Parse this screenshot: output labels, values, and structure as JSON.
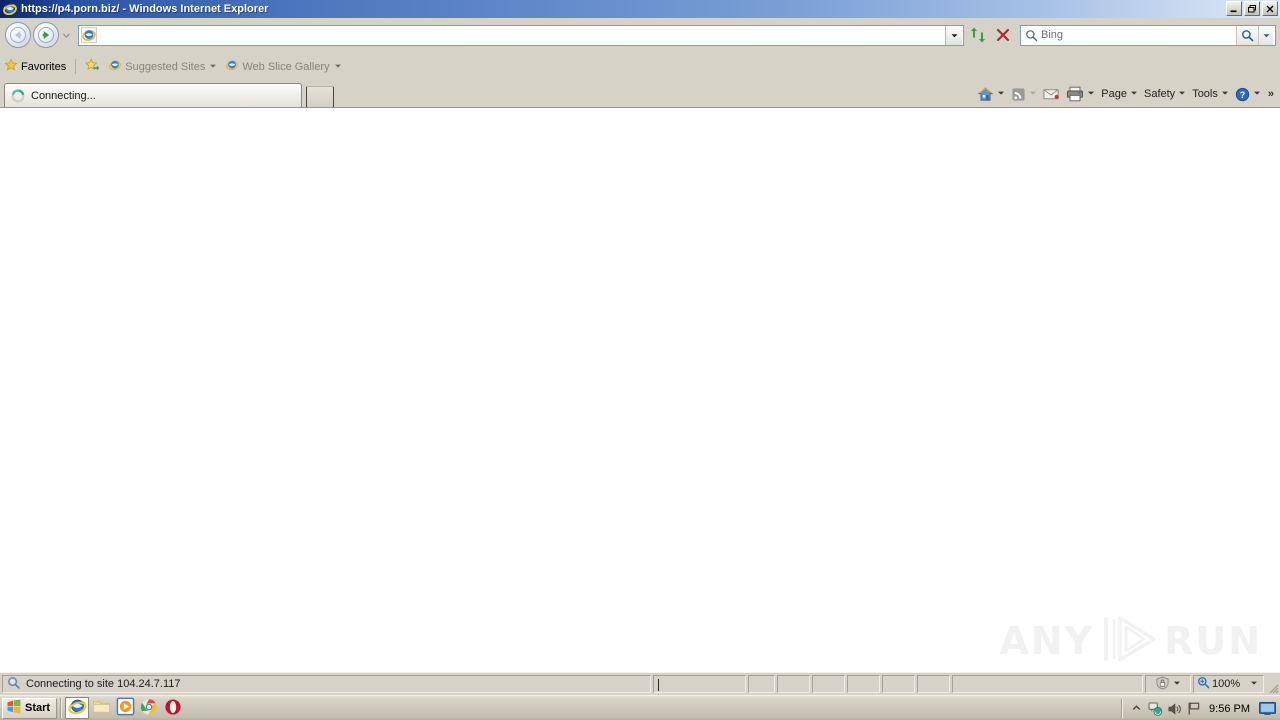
{
  "window": {
    "title": "https://p4.porn.biz/ - Windows Internet Explorer",
    "icon": "internet-explorer-icon",
    "controls": {
      "minimize_label": "Minimize",
      "restore_label": "Restore",
      "close_label": "Close"
    }
  },
  "navigation": {
    "back_label": "Back",
    "forward_label": "Forward",
    "recent_pages_label": "Recent Pages",
    "refresh_label": "Refresh",
    "stop_label": "Stop"
  },
  "address": {
    "value": "",
    "placeholder": "",
    "favicon": "internet-explorer-icon",
    "dropdown_label": "Address history"
  },
  "search": {
    "value": "",
    "placeholder": "Bing",
    "go_label": "Search",
    "options_label": "Search options"
  },
  "favorites_bar": {
    "favorites_label": "Favorites",
    "items": [
      {
        "label": "Suggested Sites",
        "icon": "internet-explorer-icon",
        "has_caret": true
      },
      {
        "label": "Web Slice Gallery",
        "icon": "internet-explorer-icon",
        "has_caret": true
      }
    ],
    "add_to_favorites_label": "Add to Favorites Bar"
  },
  "tabs": [
    {
      "label": "Connecting...",
      "icon": "loading-spinner-icon",
      "active": true
    }
  ],
  "new_tab_label": "New Tab",
  "command_bar": {
    "items": [
      {
        "name": "home",
        "label": "",
        "icon": "home-icon",
        "caret": true
      },
      {
        "name": "feeds",
        "label": "",
        "icon": "rss-feed-icon",
        "caret": true
      },
      {
        "name": "read-mail",
        "label": "",
        "icon": "mail-icon",
        "caret": false
      },
      {
        "name": "print",
        "label": "",
        "icon": "printer-icon",
        "caret": true
      },
      {
        "name": "page",
        "label": "Page",
        "icon": "",
        "caret": true
      },
      {
        "name": "safety",
        "label": "Safety",
        "icon": "",
        "caret": true
      },
      {
        "name": "tools",
        "label": "Tools",
        "icon": "",
        "caret": true
      },
      {
        "name": "help",
        "label": "",
        "icon": "help-icon",
        "caret": true
      }
    ],
    "overflow_label": "»"
  },
  "page": {
    "content": "",
    "watermark": {
      "left_text": "ANY",
      "right_text": "RUN"
    }
  },
  "status_bar": {
    "message": "Connecting to site 104.24.7.117",
    "message_icon": "magnifier-icon",
    "security_zone_icon": "internet-zone-icon",
    "zoom_level": "100%",
    "zoom_icon": "zoom-icon"
  },
  "taskbar": {
    "start_label": "Start",
    "quick_launch": [
      {
        "name": "internet-explorer",
        "icon": "internet-explorer-icon",
        "active": true
      },
      {
        "name": "show-desktop",
        "icon": "folder-icon",
        "active": false
      },
      {
        "name": "media-player",
        "icon": "media-player-icon",
        "active": false
      },
      {
        "name": "chrome",
        "icon": "chrome-icon",
        "active": false
      },
      {
        "name": "opera",
        "icon": "opera-icon",
        "active": false
      }
    ],
    "tray": {
      "show_hidden_label": "«",
      "icons": [
        {
          "name": "network-icon"
        },
        {
          "name": "volume-icon"
        },
        {
          "name": "action-flag-icon"
        }
      ],
      "clock": "9:56 PM",
      "app_icon": "monitor-icon"
    }
  },
  "colors": {
    "title_gradient_start": "#0a246a",
    "title_gradient_end": "#dce8f6",
    "chrome_bg": "#d6d2c8",
    "page_bg": "#ffffff",
    "accent_blue": "#2a53a8"
  }
}
